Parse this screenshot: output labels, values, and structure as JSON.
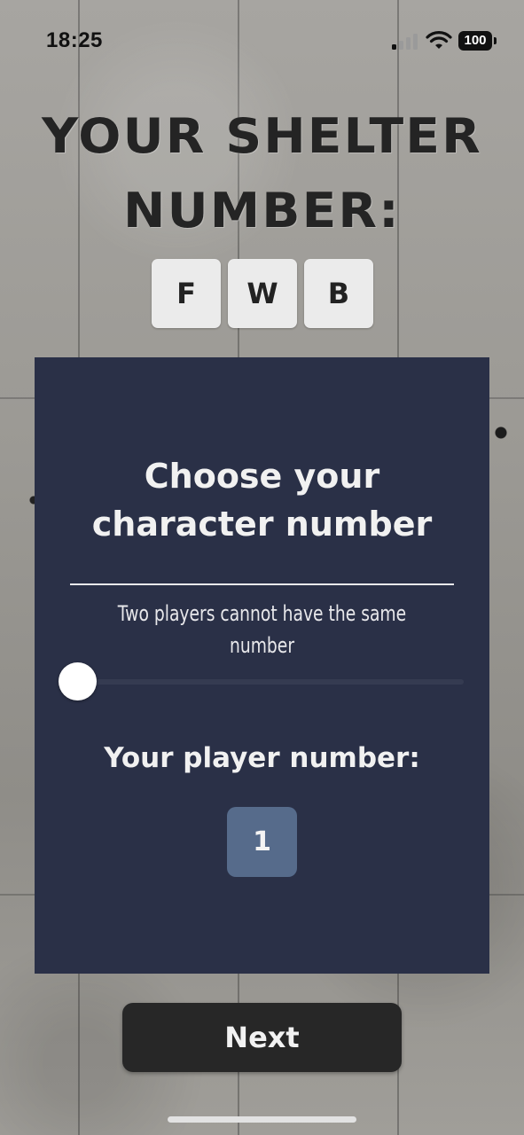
{
  "status_bar": {
    "time": "18:25",
    "battery": "100",
    "signal_icon": "cellular-signal-icon",
    "wifi_icon": "wifi-icon",
    "battery_icon": "battery-icon"
  },
  "shelter": {
    "title_line1": "YOUR SHELTER",
    "title_line2": "NUMBER:",
    "code": [
      "F",
      "W",
      "B"
    ]
  },
  "panel": {
    "heading_line1": "Choose your",
    "heading_line2": "character number",
    "hint": "Two players cannot have the same number",
    "player_label": "Your player number:",
    "player_number": "1",
    "slider_value": 1,
    "slider_fraction": 0.0
  },
  "actions": {
    "next_label": "Next"
  },
  "colors": {
    "panel_bg": "#2a3047",
    "number_tile": "#566b8b",
    "next_button_bg": "#272727",
    "code_tile_bg": "#ebebeb"
  }
}
